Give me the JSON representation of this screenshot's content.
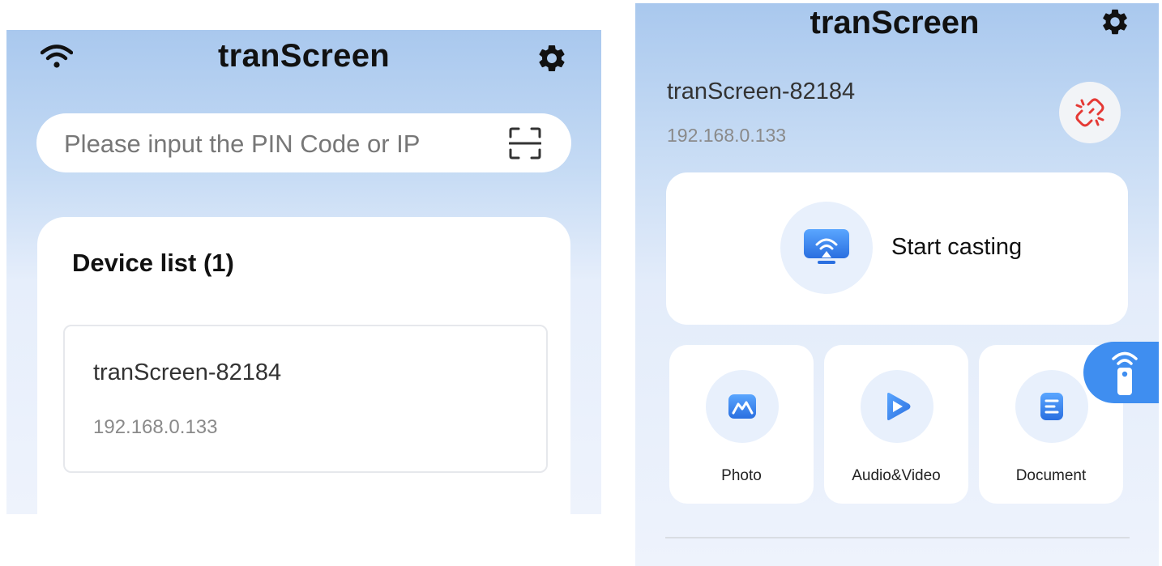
{
  "left_screen": {
    "title": "tranScreen",
    "pin_input": {
      "placeholder": "Please input the PIN Code or IP",
      "value": ""
    },
    "device_list": {
      "heading": "Device list (1)",
      "devices": [
        {
          "name": "tranScreen-82184",
          "ip": "192.168.0.133"
        }
      ]
    },
    "icons": {
      "wifi": "wifi-icon",
      "settings": "gear-icon",
      "scan": "scan-icon"
    }
  },
  "right_screen": {
    "title": "tranScreen",
    "connected_device": {
      "name": "tranScreen-82184",
      "ip": "192.168.0.133"
    },
    "cast": {
      "label": "Start casting"
    },
    "tiles": [
      {
        "label": "Photo",
        "icon": "photo-icon"
      },
      {
        "label": "Audio&Video",
        "icon": "play-icon"
      },
      {
        "label": "Document",
        "icon": "document-icon"
      }
    ],
    "icons": {
      "settings": "gear-icon",
      "disconnect": "broken-link-icon",
      "remote": "remote-icon",
      "cast": "cast-icon"
    }
  },
  "colors": {
    "accent_blue": "#3f8ef0",
    "header_gradient_top": "#a9c8ee",
    "disconnect_red": "#e53935",
    "icon_circle_bg": "#e8f0fc"
  }
}
